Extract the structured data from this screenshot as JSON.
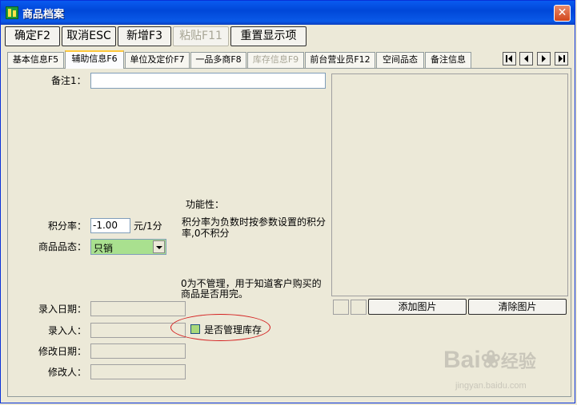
{
  "window": {
    "title": "商品档案"
  },
  "toolbar": {
    "confirm": "确定F2",
    "cancel": "取消ESC",
    "add": "新增F3",
    "paste": "粘贴F11",
    "reset": "重置显示项"
  },
  "tabs": [
    {
      "label": "基本信息F5"
    },
    {
      "label": "辅助信息F6"
    },
    {
      "label": "单位及定价F7"
    },
    {
      "label": "一品多商F8"
    },
    {
      "label": "库存信息F9"
    },
    {
      "label": "前台营业员F12"
    },
    {
      "label": "空间品态"
    },
    {
      "label": "备注信息"
    }
  ],
  "form": {
    "remark1_label": "备注1：",
    "remark1_value": "",
    "function_label": "功能性：",
    "points_rate_label": "积分率：",
    "points_rate_value": "-1.00",
    "points_rate_unit": "元/1分",
    "points_note": "积分率为负数时按参数设置的积分率,0不积分",
    "state_label": "商品品态：",
    "state_value": "只销",
    "manage_note": "0为不管理，用于知道客户购买的商品是否用完。",
    "entry_date_label": "录入日期：",
    "entry_user_label": "录入人：",
    "modify_date_label": "修改日期：",
    "modify_user_label": "修改人：",
    "manage_stock_label": "是否管理库存"
  },
  "image_panel": {
    "add_label": "添加图片",
    "clear_label": "清除图片"
  },
  "watermark": {
    "brand": "Bai",
    "brand2": "经验",
    "url": "jingyan.baidu.com"
  },
  "colors": {
    "titlebar": "#0a5bf0",
    "select_bg": "#a9e08f",
    "annotation": "#d42020",
    "tab_active_top": "#ffc83c"
  }
}
